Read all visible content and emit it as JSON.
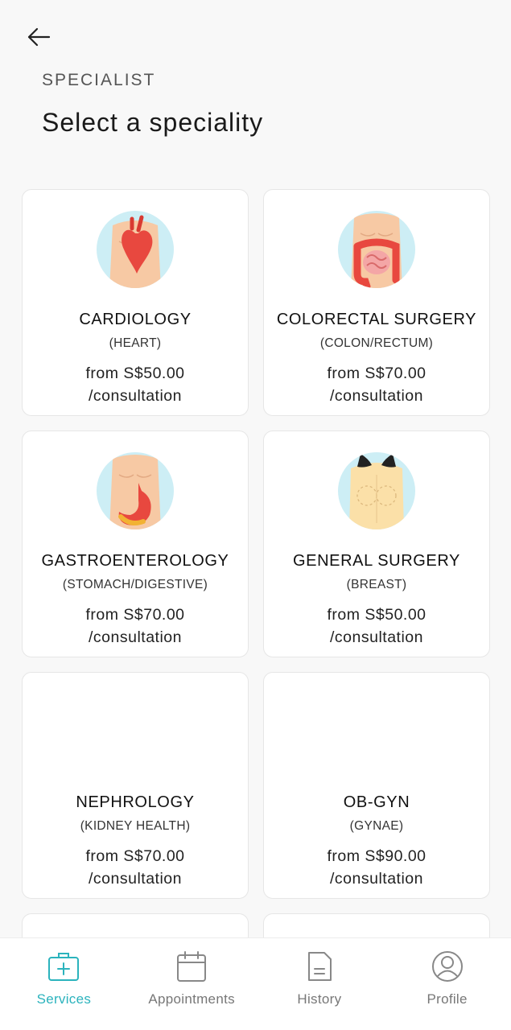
{
  "header": {
    "eyebrow": "SPECIALIST",
    "title": "Select a speciality"
  },
  "specialities": [
    {
      "name": "CARDIOLOGY",
      "sub": "(HEART)",
      "price": "from S$50.00",
      "unit": "/consultation",
      "icon": "heart-icon"
    },
    {
      "name": "COLORECTAL SURGERY",
      "sub": "(COLON/RECTUM)",
      "price": "from S$70.00",
      "unit": "/consultation",
      "icon": "colon-icon"
    },
    {
      "name": "GASTROENTEROLOGY",
      "sub": "(STOMACH/DIGESTIVE)",
      "price": "from S$70.00",
      "unit": "/consultation",
      "icon": "stomach-icon"
    },
    {
      "name": "GENERAL SURGERY",
      "sub": "(BREAST)",
      "price": "from S$50.00",
      "unit": "/consultation",
      "icon": "breast-icon"
    },
    {
      "name": "NEPHROLOGY",
      "sub": "(KIDNEY HEALTH)",
      "price": "from S$70.00",
      "unit": "/consultation",
      "icon": ""
    },
    {
      "name": "OB-GYN",
      "sub": "(GYNAE)",
      "price": "from S$90.00",
      "unit": "/consultation",
      "icon": ""
    }
  ],
  "tabs": [
    {
      "label": "Services",
      "icon": "medical-bag-icon",
      "active": true
    },
    {
      "label": "Appointments",
      "icon": "calendar-icon",
      "active": false
    },
    {
      "label": "History",
      "icon": "document-icon",
      "active": false
    },
    {
      "label": "Profile",
      "icon": "user-icon",
      "active": false
    }
  ],
  "colors": {
    "accent": "#2bb3bd",
    "skin": "#f7c9a4",
    "circle": "#cdeef5",
    "organ": "#e8483f"
  }
}
